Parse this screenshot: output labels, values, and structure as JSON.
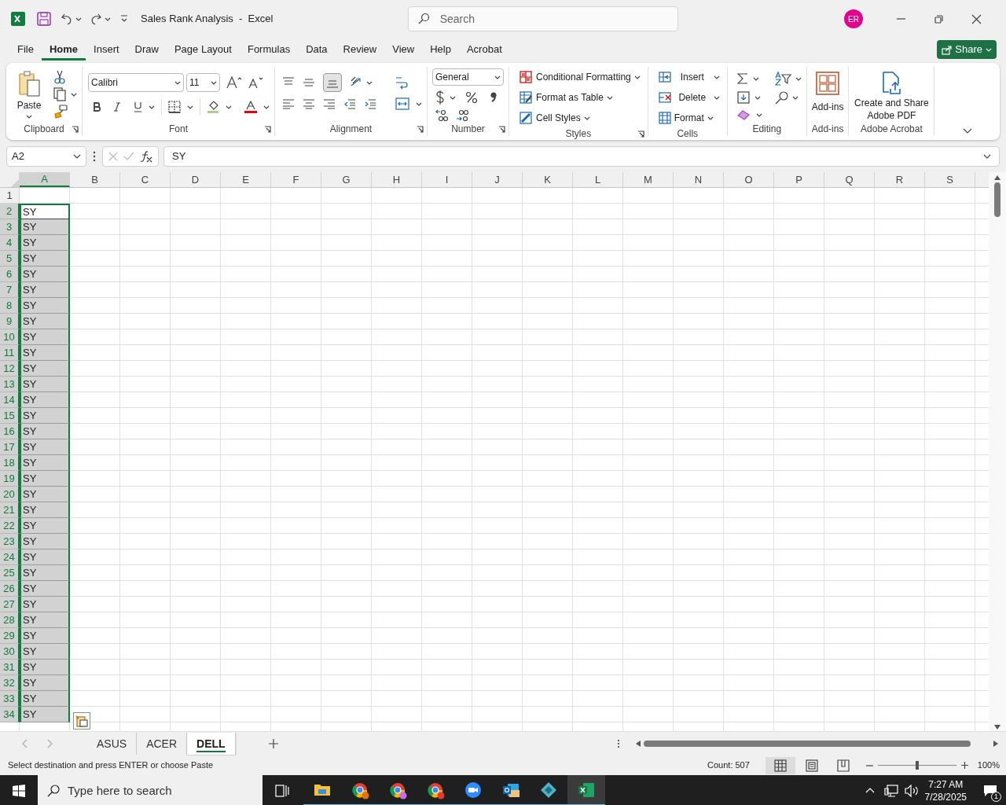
{
  "title_bar": {
    "document_title": "Sales Rank Analysis  -  Excel",
    "search_placeholder": "Search",
    "avatar_initials": "ER"
  },
  "menu_tabs": [
    {
      "label": "File",
      "selected": false
    },
    {
      "label": "Home",
      "selected": true
    },
    {
      "label": "Insert",
      "selected": false
    },
    {
      "label": "Draw",
      "selected": false
    },
    {
      "label": "Page Layout",
      "selected": false
    },
    {
      "label": "Formulas",
      "selected": false
    },
    {
      "label": "Data",
      "selected": false
    },
    {
      "label": "Review",
      "selected": false
    },
    {
      "label": "View",
      "selected": false
    },
    {
      "label": "Help",
      "selected": false
    },
    {
      "label": "Acrobat",
      "selected": false
    }
  ],
  "share_button": "Share",
  "ribbon": {
    "group_labels": [
      "Clipboard",
      "Font",
      "Alignment",
      "Number",
      "Styles",
      "Cells",
      "Editing",
      "Add-ins",
      "Adobe Acrobat"
    ],
    "paste": "Paste",
    "font_name": "Calibri",
    "font_size": "11",
    "number_format": "General",
    "styles": [
      "Conditional Formatting",
      "Format as Table",
      "Cell Styles"
    ],
    "cells": [
      "Insert",
      "Delete",
      "Format"
    ],
    "add_ins": "Add-ins",
    "acrobat": "Create and Share Adobe PDF"
  },
  "formula_bar": {
    "name_box": "A2",
    "value": "SY"
  },
  "columns": [
    {
      "label": "A",
      "selected": true
    },
    {
      "label": "B",
      "selected": false
    },
    {
      "label": "C",
      "selected": false
    },
    {
      "label": "D",
      "selected": false
    },
    {
      "label": "E",
      "selected": false
    },
    {
      "label": "F",
      "selected": false
    },
    {
      "label": "G",
      "selected": false
    },
    {
      "label": "H",
      "selected": false
    },
    {
      "label": "I",
      "selected": false
    },
    {
      "label": "J",
      "selected": false
    },
    {
      "label": "K",
      "selected": false
    },
    {
      "label": "L",
      "selected": false
    },
    {
      "label": "M",
      "selected": false
    },
    {
      "label": "N",
      "selected": false
    },
    {
      "label": "O",
      "selected": false
    },
    {
      "label": "P",
      "selected": false
    },
    {
      "label": "Q",
      "selected": false
    },
    {
      "label": "R",
      "selected": false
    },
    {
      "label": "S",
      "selected": false
    }
  ],
  "rows": [
    {
      "number": "1",
      "selected": false,
      "active": false
    },
    {
      "number": "2",
      "cell_a": "SY",
      "selected": true,
      "active": true
    },
    {
      "number": "3",
      "cell_a": "SY",
      "selected": true,
      "active": false
    },
    {
      "number": "4",
      "cell_a": "SY",
      "selected": true,
      "active": false
    },
    {
      "number": "5",
      "cell_a": "SY",
      "selected": true,
      "active": false
    },
    {
      "number": "6",
      "cell_a": "SY",
      "selected": true,
      "active": false
    },
    {
      "number": "7",
      "cell_a": "SY",
      "selected": true,
      "active": false
    },
    {
      "number": "8",
      "cell_a": "SY",
      "selected": true,
      "active": false
    },
    {
      "number": "9",
      "cell_a": "SY",
      "selected": true,
      "active": false
    },
    {
      "number": "10",
      "cell_a": "SY",
      "selected": true,
      "active": false
    },
    {
      "number": "11",
      "cell_a": "SY",
      "selected": true,
      "active": false
    },
    {
      "number": "12",
      "cell_a": "SY",
      "selected": true,
      "active": false
    },
    {
      "number": "13",
      "cell_a": "SY",
      "selected": true,
      "active": false
    },
    {
      "number": "14",
      "cell_a": "SY",
      "selected": true,
      "active": false
    },
    {
      "number": "15",
      "cell_a": "SY",
      "selected": true,
      "active": false
    },
    {
      "number": "16",
      "cell_a": "SY",
      "selected": true,
      "active": false
    },
    {
      "number": "17",
      "cell_a": "SY",
      "selected": true,
      "active": false
    },
    {
      "number": "18",
      "cell_a": "SY",
      "selected": true,
      "active": false
    },
    {
      "number": "19",
      "cell_a": "SY",
      "selected": true,
      "active": false
    },
    {
      "number": "20",
      "cell_a": "SY",
      "selected": true,
      "active": false
    },
    {
      "number": "21",
      "cell_a": "SY",
      "selected": true,
      "active": false
    },
    {
      "number": "22",
      "cell_a": "SY",
      "selected": true,
      "active": false
    },
    {
      "number": "23",
      "cell_a": "SY",
      "selected": true,
      "active": false
    },
    {
      "number": "24",
      "cell_a": "SY",
      "selected": true,
      "active": false
    },
    {
      "number": "25",
      "cell_a": "SY",
      "selected": true,
      "active": false
    },
    {
      "number": "26",
      "cell_a": "SY",
      "selected": true,
      "active": false
    },
    {
      "number": "27",
      "cell_a": "SY",
      "selected": true,
      "active": false
    },
    {
      "number": "28",
      "cell_a": "SY",
      "selected": true,
      "active": false
    },
    {
      "number": "29",
      "cell_a": "SY",
      "selected": true,
      "active": false
    },
    {
      "number": "30",
      "cell_a": "SY",
      "selected": true,
      "active": false
    },
    {
      "number": "31",
      "cell_a": "SY",
      "selected": true,
      "active": false
    },
    {
      "number": "32",
      "cell_a": "SY",
      "selected": true,
      "active": false
    },
    {
      "number": "33",
      "cell_a": "SY",
      "selected": true,
      "active": false
    },
    {
      "number": "34",
      "cell_a": "SY",
      "selected": true,
      "active": false
    }
  ],
  "sheet_tabs": [
    {
      "label": "ASUS",
      "selected": false
    },
    {
      "label": "ACER",
      "selected": false
    },
    {
      "label": "DELL",
      "selected": true
    }
  ],
  "status_bar": {
    "message": "Select destination and press ENTER or choose Paste",
    "count": "Count: 507",
    "view_buttons": [
      {
        "selected": true
      },
      {
        "selected": false
      },
      {
        "selected": false
      }
    ],
    "zoom_slider": {
      "level": 0.5
    },
    "zoom": "100%"
  },
  "taskbar": {
    "search_placeholder": "Type here to search",
    "apps": [
      {
        "selected": false
      },
      {
        "selected": false
      },
      {
        "selected": false
      },
      {
        "selected": false
      },
      {
        "selected": false
      },
      {
        "selected": false
      },
      {
        "selected": false
      },
      {
        "selected": true
      }
    ],
    "time": "7:27 AM",
    "date": "7/28/2025",
    "notification_count": "1"
  }
}
